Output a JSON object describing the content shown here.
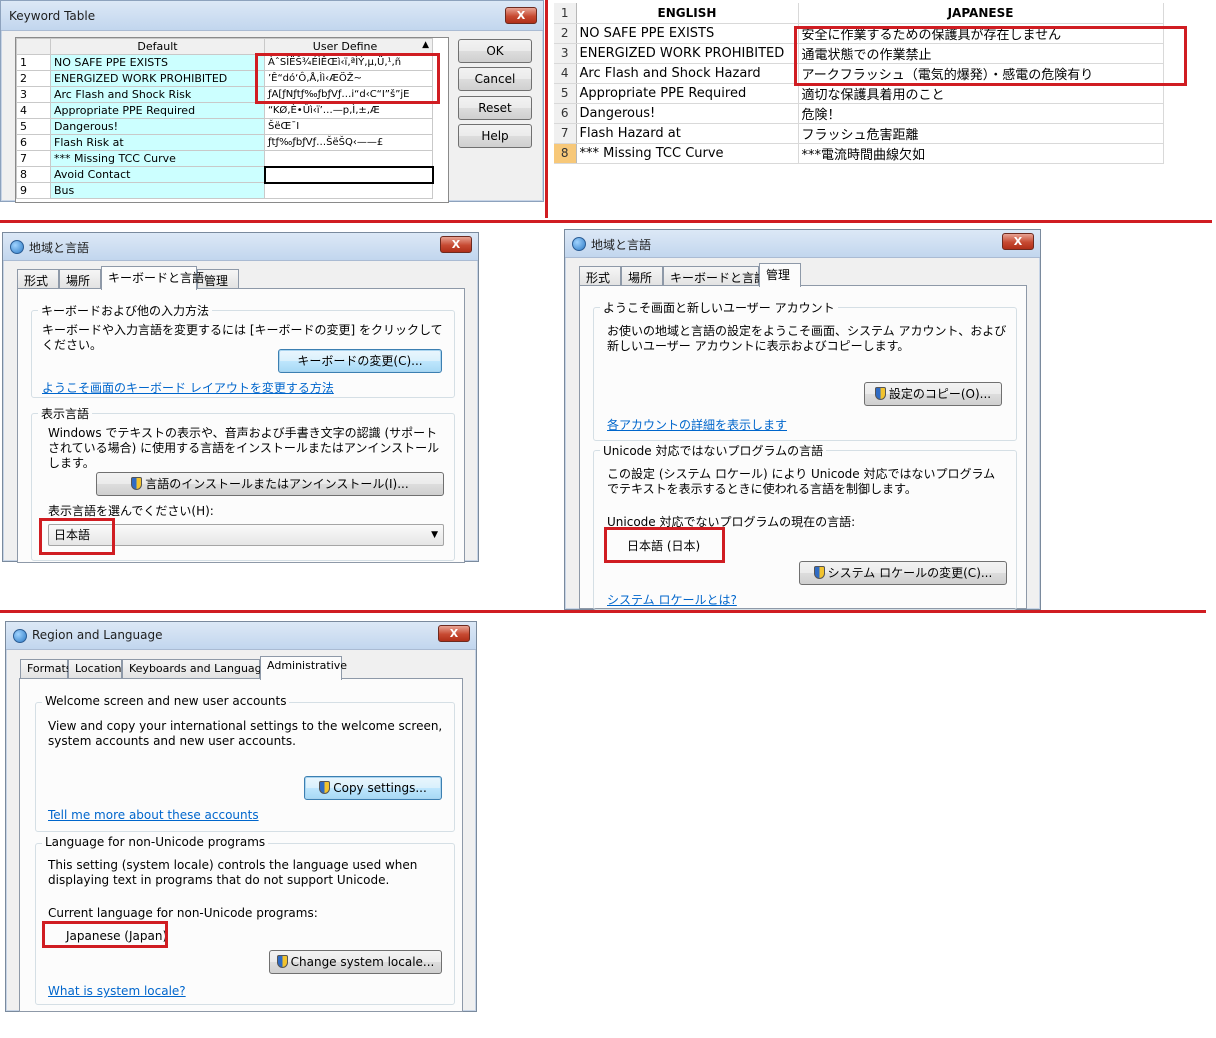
{
  "keyword_table": {
    "title": "Keyword Table",
    "close_label": "X",
    "col_default": "Default",
    "col_user": "User Define",
    "rows": [
      {
        "num": "1",
        "default": "NO SAFE PPE EXISTS",
        "user": "ÀˆSÌËŠ¾ÉÌÊŒì‹ï‚ªÌÝ‚µ‚Ü‚¹‚ñ"
      },
      {
        "num": "2",
        "default": "ENERGIZED WORK PROHIBITED",
        "user": "’Ê“dó‘Ô‚Å‚Ìì‹ÆÖŽ~"
      },
      {
        "num": "3",
        "default": "Arc Flash and Shock Risk",
        "user": "ƒA[ƒNƒtƒ‰ƒbƒVƒ…i“d‹C“I”š”­jE"
      },
      {
        "num": "4",
        "default": "Appropriate PPE Required",
        "user": "“KØ‚È•Ûì‹ï’…—p‚Ì‚±‚Æ"
      },
      {
        "num": "5",
        "default": "Dangerous!",
        "user": "ŠëŒ¯I"
      },
      {
        "num": "6",
        "default": "Flash Risk at",
        "user": "ƒtƒ‰ƒbƒVƒ…ŠëŠQ‹——£"
      },
      {
        "num": "7",
        "default": "*** Missing TCC Curve",
        "user": ""
      },
      {
        "num": "8",
        "default": "Avoid Contact",
        "user": ""
      },
      {
        "num": "9",
        "default": "Bus",
        "user": ""
      }
    ],
    "buttons": {
      "ok": "OK",
      "cancel": "Cancel",
      "reset": "Reset",
      "help": "Help"
    }
  },
  "spreadsheet": {
    "header": {
      "num": "1",
      "en": "ENGLISH",
      "jp": "JAPANESE"
    },
    "rows": [
      {
        "num": "2",
        "en": "NO SAFE PPE EXISTS",
        "jp": "安全に作業するための保護具が存在しません"
      },
      {
        "num": "3",
        "en": "ENERGIZED WORK PROHIBITED",
        "jp": "通電状態での作業禁止"
      },
      {
        "num": "4",
        "en": "Arc Flash and Shock Hazard",
        "jp": "アークフラッシュ（電気的爆発）・感電の危険有り"
      },
      {
        "num": "5",
        "en": "Appropriate PPE Required",
        "jp": "適切な保護具着用のこと"
      },
      {
        "num": "6",
        "en": "Dangerous!",
        "jp": "危険！"
      },
      {
        "num": "7",
        "en": "Flash Hazard at",
        "jp": "フラッシュ危害距離"
      },
      {
        "num": "8",
        "en": "*** Missing TCC Curve",
        "jp": "***電流時間曲線欠如"
      }
    ]
  },
  "jp_keyboard": {
    "title": "地域と言語",
    "close_label": "X",
    "tabs": [
      "形式",
      "場所",
      "キーボードと言語",
      "管理"
    ],
    "group1_title": "キーボードおよび他の入力方法",
    "group1_desc": "キーボードや入力言語を変更するには [キーボードの変更] をクリックしてください。",
    "change_keyboard_btn": "キーボードの変更(C)...",
    "keyboard_link": "ようこそ画面のキーボード レイアウトを変更する方法",
    "group2_title": "表示言語",
    "group2_desc": "Windows でテキストの表示や、音声および手書き文字の認識 (サポートされている場合) に使用する言語をインストールまたはアンインストールします。",
    "install_btn": "言語のインストールまたはアンインストール(I)...",
    "choose_label": "表示言語を選んでください(H):",
    "display_lang_value": "日本語"
  },
  "jp_admin": {
    "title": "地域と言語",
    "close_label": "X",
    "tabs": [
      "形式",
      "場所",
      "キーボードと言語",
      "管理"
    ],
    "group1_title": "ようこそ画面と新しいユーザー アカウント",
    "group1_desc": "お使いの地域と言語の設定をようこそ画面、システム アカウント、および新しいユーザー アカウントに表示およびコピーします。",
    "copy_btn": "設定のコピー(O)...",
    "accounts_link": "各アカウントの詳細を表示します",
    "group2_title": "Unicode 対応ではないプログラムの言語",
    "group2_desc": "この設定 (システム ロケール) により Unicode 対応ではないプログラムでテキストを表示するときに使われる言語を制御します。",
    "current_label": "Unicode 対応でないプログラムの現在の言語:",
    "current_value": "日本語 (日本)",
    "change_locale_btn": "システム ロケールの変更(C)...",
    "locale_link": "システム ロケールとは?"
  },
  "en_admin": {
    "title": "Region and Language",
    "close_label": "X",
    "tabs": [
      "Formats",
      "Location",
      "Keyboards and Languages",
      "Administrative"
    ],
    "group1_title": "Welcome screen and new user accounts",
    "group1_desc": "View and copy your international settings to the welcome screen, system accounts and new user accounts.",
    "copy_btn": "Copy settings...",
    "accounts_link": "Tell me more about these accounts",
    "group2_title": "Language for non-Unicode programs",
    "group2_desc": "This setting (system locale) controls the language used when displaying text in programs that do not support Unicode.",
    "current_label": "Current language for non-Unicode programs:",
    "current_value": "Japanese (Japan)",
    "change_locale_btn": "Change system locale...",
    "locale_link": "What is system locale?"
  },
  "colors": {
    "highlight_red": "#d01d22",
    "cyan_cells": "#ccffff",
    "link_blue": "#0066cc"
  }
}
